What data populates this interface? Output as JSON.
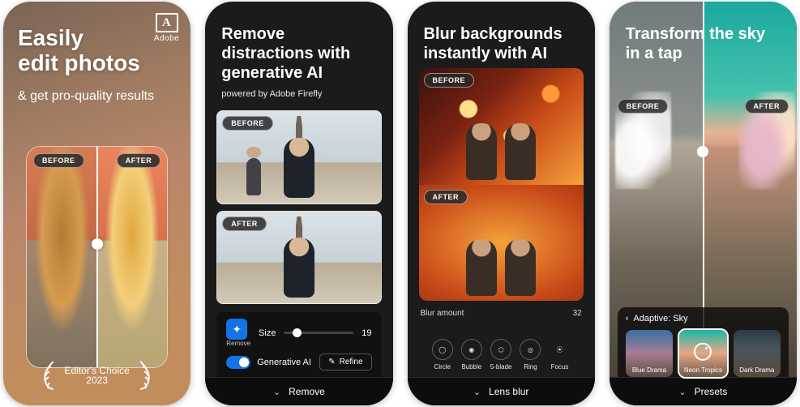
{
  "labels": {
    "before": "BEFORE",
    "after": "AFTER"
  },
  "p1": {
    "logo": "Adobe",
    "logo_letter": "A",
    "title_l1": "Easily",
    "title_l2": "edit photos",
    "subtitle": "& get pro-quality results",
    "award_text": "Editor's Choice",
    "award_year": "2023"
  },
  "p2": {
    "title": "Remove distractions with generative AI",
    "subtitle": "powered by Adobe Firefly",
    "control": {
      "remove_tag": "Remove",
      "size_label": "Size",
      "size_value": "19",
      "gen_ai_label": "Generative AI",
      "refine_label": "Refine"
    },
    "bottom": "Remove"
  },
  "p3": {
    "title": "Blur backgrounds instantly with AI",
    "blur_label": "Blur amount",
    "blur_value": "32",
    "options": [
      "Circle",
      "Bubble",
      "5-blade",
      "Ring",
      "Focus"
    ],
    "bottom": "Lens blur"
  },
  "p4": {
    "title": "Transform the sky in a tap",
    "crumb": "Adaptive: Sky",
    "thumbs": [
      "Blue Drama",
      "Neon Tropics",
      "Dark Drama"
    ],
    "bottom": "Presets"
  }
}
